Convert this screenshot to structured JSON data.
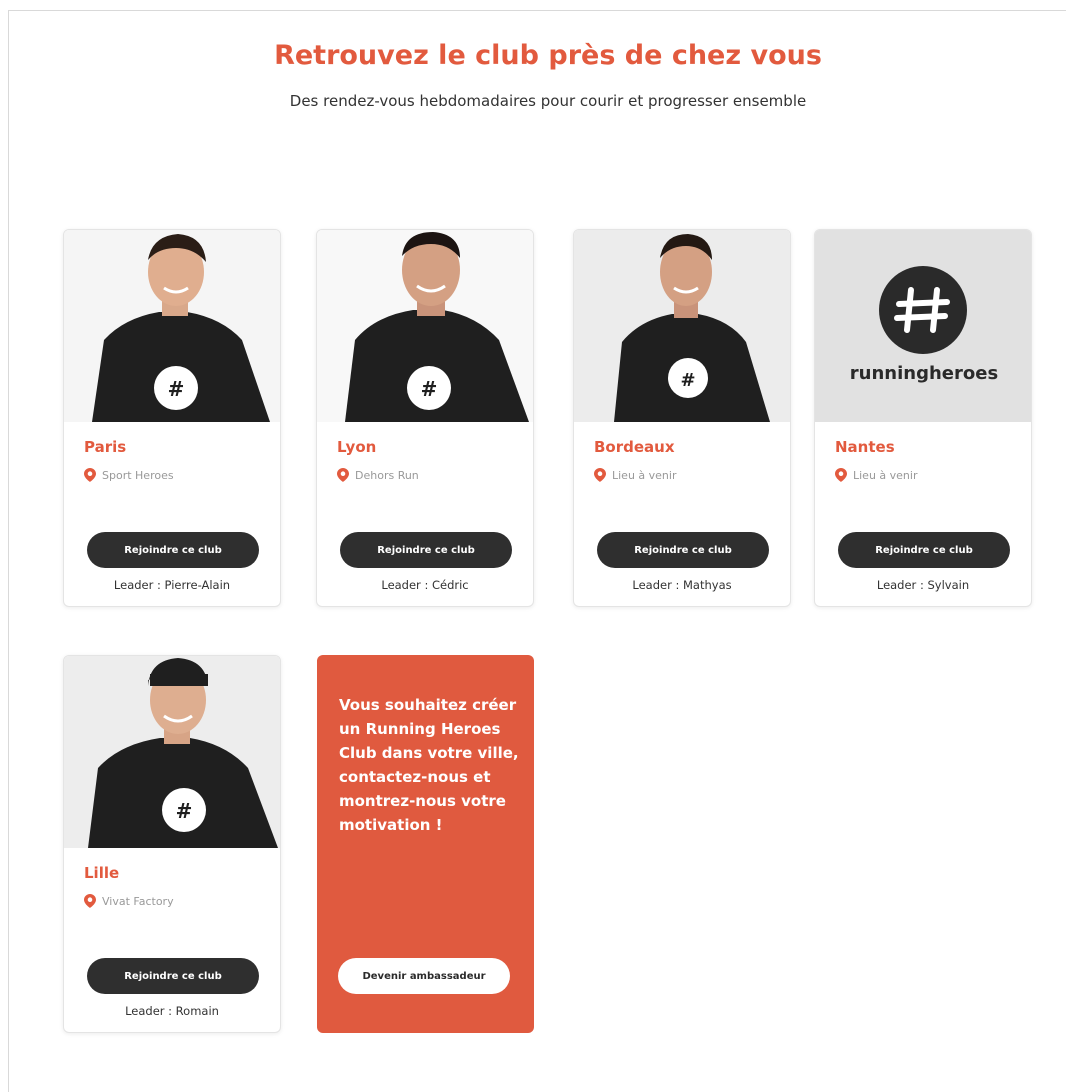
{
  "header": {
    "title": "Retrouvez le club près de chez vous",
    "subtitle": "Des rendez-vous hebdomadaires pour courir et progresser ensemble"
  },
  "clubs": [
    {
      "city": "Paris",
      "location": "Sport Heroes",
      "button_label": "Rejoindre ce club",
      "leader": "Leader : Pierre-Alain"
    },
    {
      "city": "Lyon",
      "location": "Dehors Run",
      "button_label": "Rejoindre ce club",
      "leader": "Leader : Cédric"
    },
    {
      "city": "Bordeaux",
      "location": "Lieu à venir",
      "button_label": "Rejoindre ce club",
      "leader": "Leader : Mathyas"
    },
    {
      "city": "Nantes",
      "location": "Lieu à venir",
      "button_label": "Rejoindre ce club",
      "leader": "Leader : Sylvain",
      "logo_text": "runningheroes"
    },
    {
      "city": "Lille",
      "location": "Vivat Factory",
      "button_label": "Rejoindre ce club",
      "leader": "Leader : Romain"
    }
  ],
  "promo": {
    "text": "Vous souhaitez créer un Running Heroes Club dans votre ville, contactez-nous et montrez-nous votre motivation !",
    "button_label": "Devenir ambassadeur"
  },
  "colors": {
    "accent": "#e25a3e",
    "button": "#2f2f2f"
  },
  "icons": [
    "location-pin-icon",
    "running-heroes-logo-icon"
  ]
}
